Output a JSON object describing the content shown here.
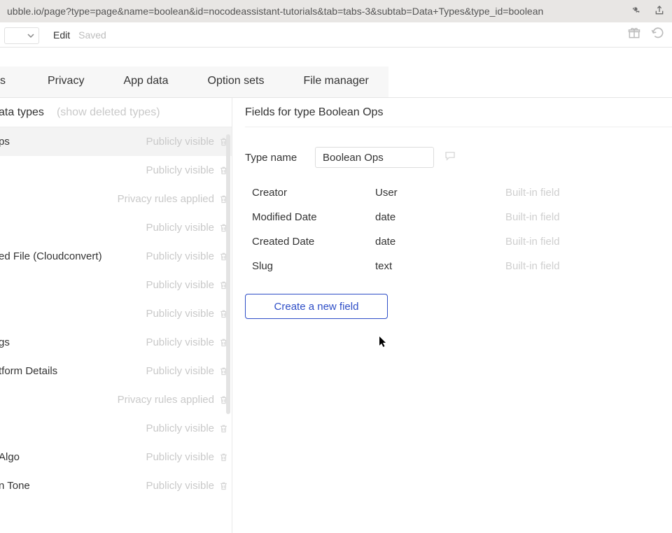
{
  "browser": {
    "url": "ubble.io/page?type=page&name=boolean&id=nocodeassistant-tutorials&tab=tabs-3&subtab=Data+Types&type_id=boolean"
  },
  "toolbar": {
    "edit": "Edit",
    "saved": "Saved"
  },
  "tabs": {
    "t0": "s",
    "t1": "Privacy",
    "t2": "App data",
    "t3": "Option sets",
    "t4": "File manager"
  },
  "left": {
    "header": "ata types",
    "show_deleted": "(show deleted types)",
    "rows": [
      {
        "name": "ps",
        "vis": "Publicly visible",
        "selected": true
      },
      {
        "name": "",
        "vis": "Publicly visible"
      },
      {
        "name": "",
        "vis": "Privacy rules applied"
      },
      {
        "name": "",
        "vis": "Publicly visible"
      },
      {
        "name": "ed File (Cloudconvert)",
        "vis": "Publicly visible"
      },
      {
        "name": "",
        "vis": "Publicly visible"
      },
      {
        "name": "",
        "vis": "Publicly visible"
      },
      {
        "name": "gs",
        "vis": "Publicly visible"
      },
      {
        "name": "tform Details",
        "vis": "Publicly visible"
      },
      {
        "name": "",
        "vis": "Privacy rules applied"
      },
      {
        "name": "",
        "vis": "Publicly visible"
      },
      {
        "name": "Algo",
        "vis": "Publicly visible"
      },
      {
        "name": "n Tone",
        "vis": "Publicly visible"
      }
    ]
  },
  "right": {
    "header": "Fields for type Boolean Ops",
    "type_name_label": "Type name",
    "type_name_value": "Boolean Ops",
    "fields": [
      {
        "name": "Creator",
        "type": "User",
        "builtin": "Built-in field"
      },
      {
        "name": "Modified Date",
        "type": "date",
        "builtin": "Built-in field"
      },
      {
        "name": "Created Date",
        "type": "date",
        "builtin": "Built-in field"
      },
      {
        "name": "Slug",
        "type": "text",
        "builtin": "Built-in field"
      }
    ],
    "create_field": "Create a new field"
  }
}
